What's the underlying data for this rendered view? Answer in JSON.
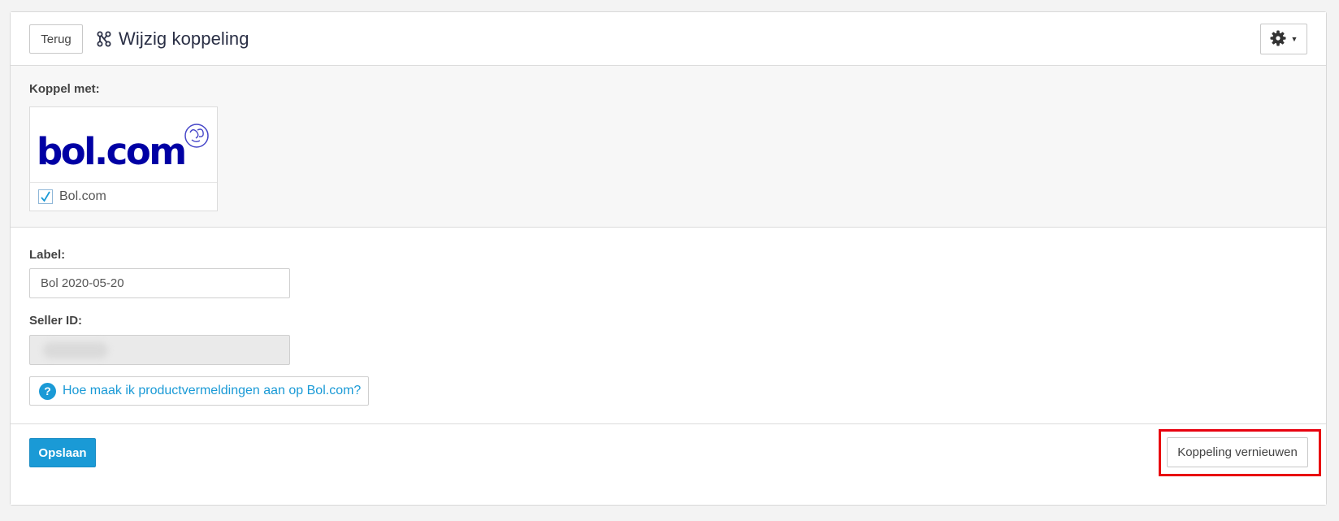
{
  "header": {
    "back_label": "Terug",
    "title": "Wijzig koppeling",
    "title_icon": "link-nodes-icon",
    "settings_icon": "gear-icon"
  },
  "connect": {
    "label": "Koppel met:",
    "tile": {
      "logo_text": "bol.com",
      "name": "Bol.com",
      "checked": true
    }
  },
  "form": {
    "label_field": {
      "label": "Label:",
      "value": "Bol 2020-05-20"
    },
    "seller_field": {
      "label": "Seller ID:",
      "value": ""
    },
    "help_link": "Hoe maak ik productvermeldingen aan op Bol.com?"
  },
  "footer": {
    "save_label": "Opslaan",
    "renew_label": "Koppeling vernieuwen"
  },
  "colors": {
    "accent": "#1a9ad6",
    "bol_blue": "#0000a4",
    "highlight": "#e8000f"
  }
}
